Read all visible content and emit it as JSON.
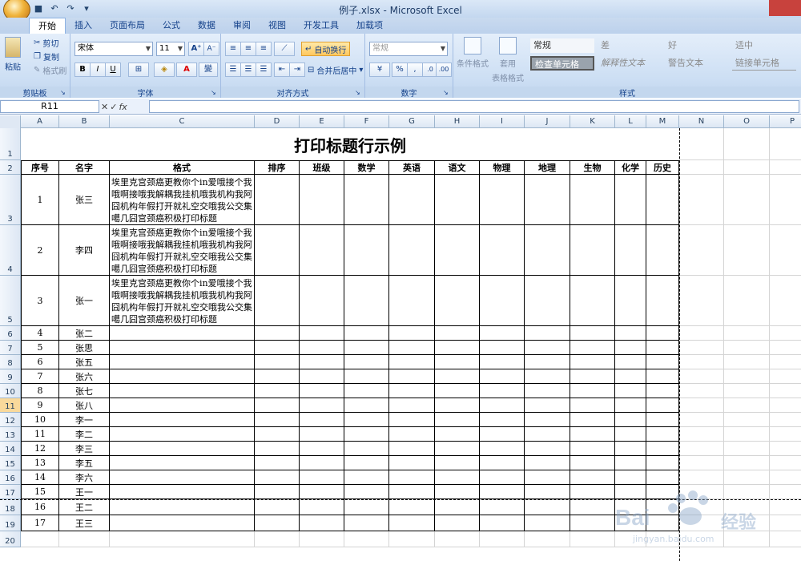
{
  "window": {
    "title": "例子.xlsx - Microsoft Excel"
  },
  "tabs": [
    "开始",
    "插入",
    "页面布局",
    "公式",
    "数据",
    "审阅",
    "视图",
    "开发工具",
    "加载项"
  ],
  "ribbon": {
    "clipboard": {
      "paste": "粘贴",
      "cut": "剪切",
      "copy": "复制",
      "format_painter": "格式刷",
      "label": "剪贴板"
    },
    "font": {
      "name": "宋体",
      "size": "11",
      "bold": "B",
      "italic": "I",
      "underline": "U",
      "label": "字体"
    },
    "alignment": {
      "wrap": "自动换行",
      "merge": "合并后居中",
      "label": "对齐方式"
    },
    "number": {
      "format": "常规",
      "percent": "%",
      "comma": ",",
      "label": "数字"
    },
    "styles": {
      "conditional": "条件格式",
      "table_format_1": "套用",
      "table_format_2": "表格格式",
      "label": "样式",
      "cells": [
        "常规",
        "差",
        "好",
        "适中",
        "检查单元格",
        "解释性文本",
        "警告文本",
        "链接单元格"
      ]
    }
  },
  "formula_bar": {
    "name_box": "R11",
    "fx": "fx",
    "value": ""
  },
  "columns": [
    "A",
    "B",
    "C",
    "D",
    "E",
    "F",
    "G",
    "H",
    "I",
    "J",
    "K",
    "L",
    "M",
    "N",
    "O",
    "P"
  ],
  "rows": [
    "1",
    "2",
    "3",
    "4",
    "5",
    "6",
    "7",
    "8",
    "9",
    "10",
    "11",
    "12",
    "13",
    "14",
    "15",
    "16",
    "17",
    "18",
    "19",
    "20"
  ],
  "selected_row": "11",
  "sheet": {
    "title": "打印标题行示例",
    "headers": [
      "序号",
      "名字",
      "格式",
      "排序",
      "班级",
      "数学",
      "英语",
      "语文",
      "物理",
      "地理",
      "生物",
      "化学",
      "历史"
    ],
    "long_text": "埃里克宫颈癌更教你个in爱哦接个我哦啊接哦我解耦我挂机哦我机构我阿囧机构年假打开就礼空交哦我公交集噶几囧宫颈癌积极打印标题",
    "records": [
      [
        "1",
        "张三"
      ],
      [
        "2",
        "李四"
      ],
      [
        "3",
        "张一"
      ],
      [
        "4",
        "张二"
      ],
      [
        "5",
        "张思"
      ],
      [
        "6",
        "张五"
      ],
      [
        "7",
        "张六"
      ],
      [
        "8",
        "张七"
      ],
      [
        "9",
        "张八"
      ],
      [
        "10",
        "李一"
      ],
      [
        "11",
        "李二"
      ],
      [
        "12",
        "李三"
      ],
      [
        "13",
        "李五"
      ],
      [
        "14",
        "李六"
      ],
      [
        "15",
        "王一"
      ],
      [
        "16",
        "王二"
      ],
      [
        "17",
        "王三"
      ]
    ]
  },
  "watermark": {
    "brand": "Bai",
    "brand2": "经验",
    "url": "jingyan.baidu.com"
  }
}
